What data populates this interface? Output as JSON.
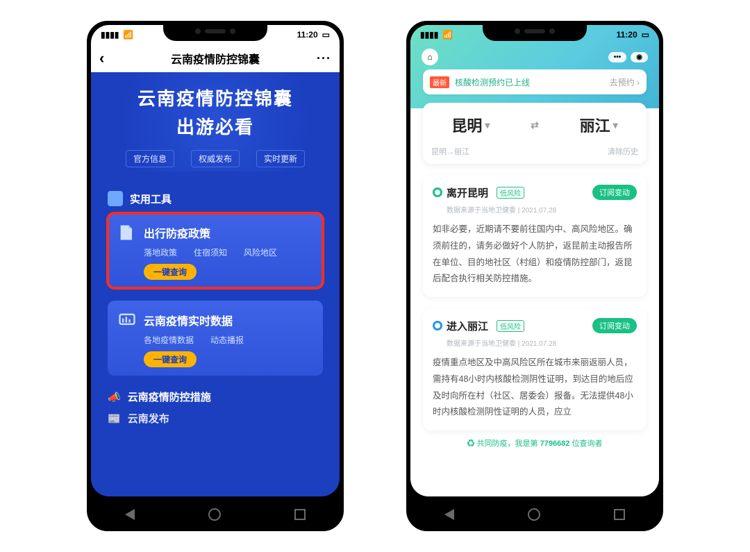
{
  "status": {
    "time": "11:20"
  },
  "left": {
    "title": "云南疫情防控锦囊",
    "hero_line1": "云南疫情防控锦囊",
    "hero_line2": "出游必看",
    "badges": [
      "官方信息",
      "权威发布",
      "实时更新"
    ],
    "section_tools": "实用工具",
    "card1": {
      "title": "出行防疫政策",
      "subs": [
        "落地政策",
        "住宿须知",
        "风险地区"
      ],
      "btn": "一键查询"
    },
    "card2": {
      "title": "云南疫情实时数据",
      "subs": [
        "各地疫情数据",
        "动态播报"
      ],
      "btn": "一键查询"
    },
    "item3": "云南疫情防控措施",
    "item4": "云南发布"
  },
  "right": {
    "notice": {
      "tag": "最新",
      "text": "核酸检测预约已上线",
      "go": "去预约"
    },
    "route": {
      "from": "昆明",
      "to": "丽江",
      "history": "昆明→丽江",
      "clear": "清除历史"
    },
    "cards": [
      {
        "pin": "green",
        "title": "离开昆明",
        "risk": "低风险",
        "subscribe": "订阅变动",
        "source": "数据来源于当地卫健委 | 2021.07.28",
        "body": "如非必要，近期请不要前往国内中、高风险地区。确须前往的，请务必做好个人防护，返昆前主动报告所在单位、目的地社区（村组）和疫情防控部门，返昆后配合执行相关防控措施。"
      },
      {
        "pin": "blue",
        "title": "进入丽江",
        "risk": "低风险",
        "subscribe": "订阅变动",
        "source": "数据来源于当地卫健委 | 2021.07.28",
        "body": "疫情重点地区及中高风险区所在城市来丽返丽人员，需持有48小时内核酸检测阴性证明，到达目的地后应及时向所在村（社区、居委会）报备。无法提供48小时内核酸检测阴性证明的人员，应立"
      }
    ],
    "footer_pre": "共同防疫，我是第 ",
    "footer_num": "7796682",
    "footer_post": " 位查询者"
  }
}
